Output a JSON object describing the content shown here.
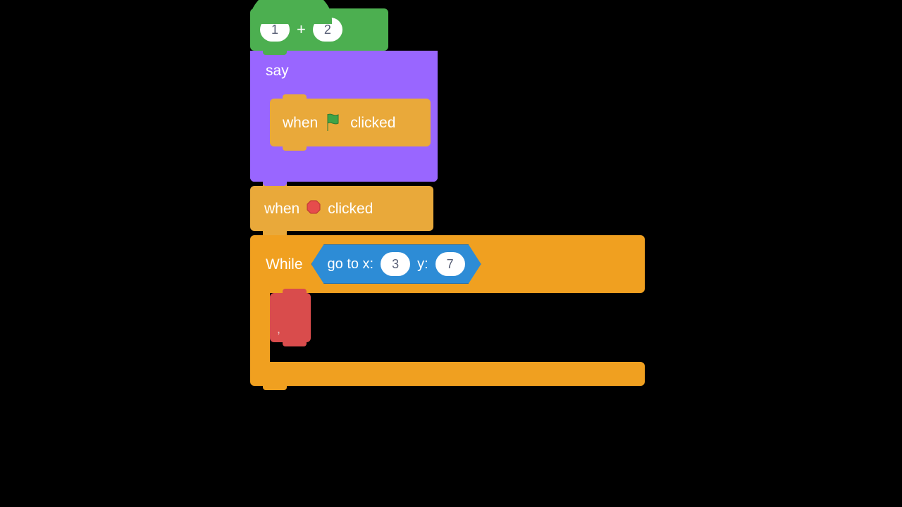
{
  "hat": {
    "arg1": "1",
    "op": "+",
    "arg2": "2"
  },
  "say": {
    "label": "say",
    "inner": {
      "when": "when",
      "clicked": "clicked"
    }
  },
  "event_stop": {
    "when": "when",
    "clicked": "clicked"
  },
  "while": {
    "label": "While",
    "cond": {
      "prefix": "go to x:",
      "x": "3",
      "ylabel": "y:",
      "y": "7"
    },
    "body_text": ","
  }
}
